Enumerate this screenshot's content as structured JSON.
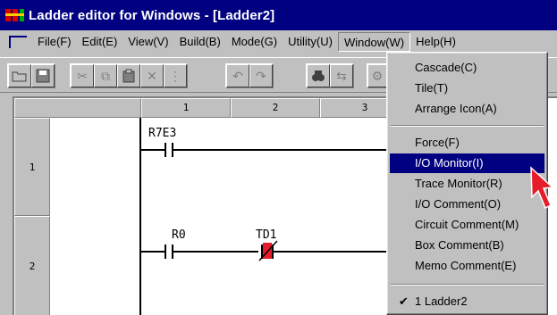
{
  "window": {
    "title": "Ladder editor for Windows - [Ladder2]"
  },
  "menubar": {
    "items": [
      {
        "label": "File(F)",
        "active": false
      },
      {
        "label": "Edit(E)",
        "active": false
      },
      {
        "label": "View(V)",
        "active": false
      },
      {
        "label": "Build(B)",
        "active": false
      },
      {
        "label": "Mode(G)",
        "active": false
      },
      {
        "label": "Utility(U)",
        "active": false
      },
      {
        "label": "Window(W)",
        "active": true
      },
      {
        "label": "Help(H)",
        "active": false
      }
    ]
  },
  "toolbar": {
    "icons": [
      "open-icon",
      "save-icon",
      "cut-icon",
      "copy-icon",
      "paste-icon",
      "delete-icon",
      "insert-icon",
      "undo-icon",
      "redo-icon",
      "find-icon",
      "replace-icon",
      "monitor-icon"
    ]
  },
  "editor": {
    "columns": [
      "1",
      "2",
      "3"
    ],
    "rows": [
      "1",
      "2"
    ],
    "contacts": [
      {
        "label": "R7E3",
        "type": "no-contact"
      },
      {
        "label": "R0",
        "type": "no-contact"
      },
      {
        "label": "TD1",
        "type": "nc-contact-highlight"
      }
    ]
  },
  "window_menu": {
    "items": [
      {
        "label": "Cascade(C)",
        "highlight": false,
        "checked": false
      },
      {
        "label": "Tile(T)",
        "highlight": false,
        "checked": false
      },
      {
        "label": "Arrange Icon(A)",
        "highlight": false,
        "checked": false
      },
      {
        "label": "Force(F)",
        "highlight": false,
        "checked": false
      },
      {
        "label": "I/O Monitor(I)",
        "highlight": true,
        "checked": false
      },
      {
        "label": "Trace Monitor(R)",
        "highlight": false,
        "checked": false
      },
      {
        "label": "I/O Comment(O)",
        "highlight": false,
        "checked": false
      },
      {
        "label": "Circuit Comment(M)",
        "highlight": false,
        "checked": false
      },
      {
        "label": "Box Comment(B)",
        "highlight": false,
        "checked": false
      },
      {
        "label": "Memo Comment(E)",
        "highlight": false,
        "checked": false
      },
      {
        "label": "1 Ladder2",
        "highlight": false,
        "checked": true
      }
    ]
  },
  "colors": {
    "title_bar": "#000080",
    "highlight": "#000080",
    "accent_red": "#e51d2a"
  }
}
